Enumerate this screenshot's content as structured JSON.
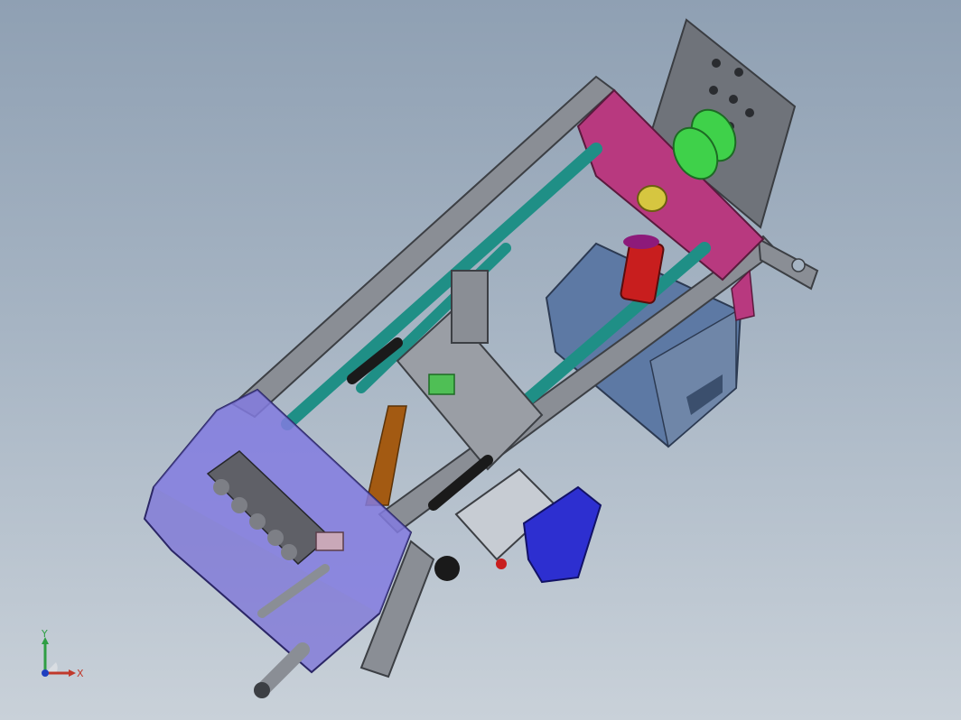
{
  "viewport": {
    "background_top": "#8fa0b3",
    "background_bottom": "#c9d1d9"
  },
  "model": {
    "frame_color": "#7f838a",
    "rail_color": "#1f8f86",
    "bracket_color": "#b8397f",
    "gear_color": "#3fd14a",
    "guard_color": "#7b72d8",
    "motor_color": "#5e7aa6",
    "cylinder_color": "#c81e1e",
    "blue_part_color": "#2d2fd0"
  },
  "triad": {
    "x_label": "X",
    "y_label": "Y",
    "x_color": "#c0392b",
    "y_color": "#2f9e44",
    "z_color": "#1f3fbf"
  }
}
